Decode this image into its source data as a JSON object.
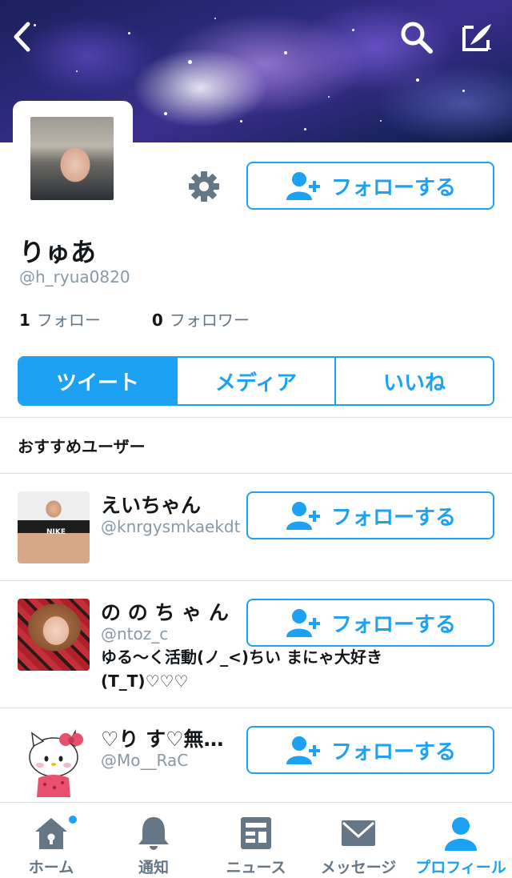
{
  "profile": {
    "name": "りゅあ",
    "handle": "@h_ryua0820",
    "following_count": "1",
    "following_label": "フォロー",
    "followers_count": "0",
    "followers_label": "フォロワー",
    "follow_label": "フォローする"
  },
  "tabs": [
    {
      "label": "ツイート",
      "active": true
    },
    {
      "label": "メディア",
      "active": false
    },
    {
      "label": "いいね",
      "active": false
    }
  ],
  "suggestions": {
    "title": "おすすめユーザー",
    "users": [
      {
        "name": "えいちゃん",
        "handle": "@knrgysmkaekdt",
        "bio": "",
        "follow_label": "フォローする"
      },
      {
        "name": "の の ち ゃ ん",
        "handle": "@ntoz_c",
        "bio": "ゆる〜く活動(ノ_<)ちい まにゃ大好き(T_T)♡♡♡",
        "follow_label": "フォローする"
      },
      {
        "name": "♡り す♡無…",
        "handle": "@Mo__RaC",
        "bio": "",
        "follow_label": "フォローする"
      }
    ]
  },
  "nav": [
    {
      "label": "ホーム",
      "icon": "home-icon",
      "active": false
    },
    {
      "label": "通知",
      "icon": "bell-icon",
      "active": false
    },
    {
      "label": "ニュース",
      "icon": "news-icon",
      "active": false
    },
    {
      "label": "メッセージ",
      "icon": "envelope-icon",
      "active": false
    },
    {
      "label": "プロフィール",
      "icon": "person-icon",
      "active": true
    }
  ],
  "colors": {
    "accent": "#1da1f2",
    "muted": "#8899a6",
    "nav_inactive": "#657786"
  }
}
